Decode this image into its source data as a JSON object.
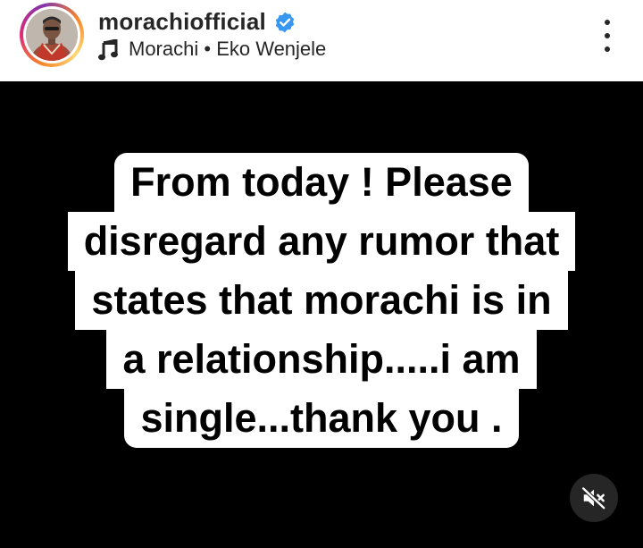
{
  "post_header": {
    "username": "morachiofficial",
    "verified": true,
    "audio_artist": "Morachi",
    "audio_separator": " • ",
    "audio_track": "Eko Wenjele"
  },
  "media": {
    "background_color": "#000000",
    "text_lines": [
      "From today ! Please",
      "disregard any rumor that",
      "states that morachi is in",
      "a relationship.....i am",
      "single...thank you ."
    ],
    "audio_state": "muted"
  },
  "icons": {
    "verified": "verified-badge-icon",
    "music": "music-note-icon",
    "more": "more-options-icon",
    "mute": "speaker-muted-icon"
  },
  "colors": {
    "verified_blue": "#3897f0",
    "text_dark": "#262626"
  }
}
